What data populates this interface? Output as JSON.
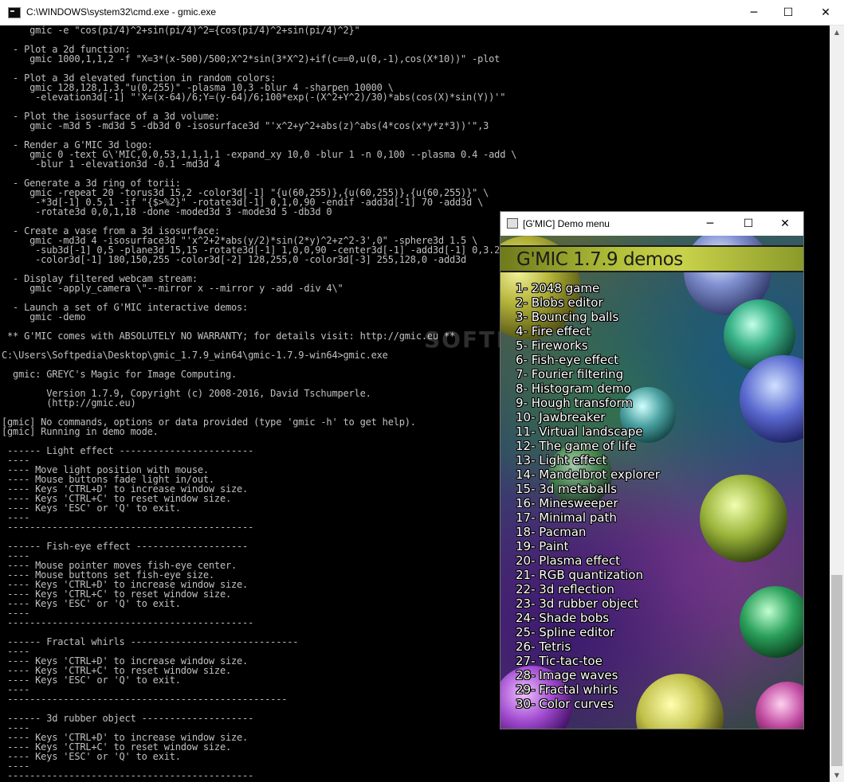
{
  "cmd": {
    "title": "C:\\WINDOWS\\system32\\cmd.exe - gmic.exe",
    "lines": [
      "     gmic -e \"cos(pi/4)^2+sin(pi/4)^2={cos(pi/4)^2+sin(pi/4)^2}\"",
      "",
      "  - Plot a 2d function:",
      "     gmic 1000,1,1,2 -f \"X=3*(x-500)/500;X^2*sin(3*X^2)+if(c==0,u(0,-1),cos(X*10))\" -plot",
      "",
      "  - Plot a 3d elevated function in random colors:",
      "     gmic 128,128,1,3,\"u(0,255)\" -plasma 10,3 -blur 4 -sharpen 10000 \\",
      "      -elevation3d[-1] \"'X=(x-64)/6;Y=(y-64)/6;100*exp(-(X^2+Y^2)/30)*abs(cos(X)*sin(Y))'\"",
      "",
      "  - Plot the isosurface of a 3d volume:",
      "     gmic -m3d 5 -md3d 5 -db3d 0 -isosurface3d \"'x^2+y^2+abs(z)^abs(4*cos(x*y*z*3))'\",3",
      "",
      "  - Render a G'MIC 3d logo:",
      "     gmic 0 -text G\\'MIC,0,0,53,1,1,1,1 -expand_xy 10,0 -blur 1 -n 0,100 --plasma 0.4 -add \\",
      "      -blur 1 -elevation3d -0.1 -md3d 4",
      "",
      "  - Generate a 3d ring of torii:",
      "     gmic -repeat 20 -torus3d 15,2 -color3d[-1] \"{u(60,255)},{u(60,255)},{u(60,255)}\" \\",
      "      -*3d[-1] 0.5,1 -if \"{$>%2}\" -rotate3d[-1] 0,1,0,90 -endif -add3d[-1] 70 -add3d \\",
      "      -rotate3d 0,0,1,18 -done -moded3d 3 -mode3d 5 -db3d 0",
      "",
      "  - Create a vase from a 3d isosurface:",
      "     gmic -md3d 4 -isosurface3d \"'x^2+2*abs(y/2)*sin(2*y)^2+z^2-3',0\" -sphere3d 1.5 \\",
      "      -sub3d[-1] 0,5 -plane3d 15,15 -rotate3d[-1] 1,0,0,90 -center3d[-1] -add3d[-1] 0,3.2 \\",
      "      -color3d[-1] 180,150,255 -color3d[-2] 128,255,0 -color3d[-3] 255,128,0 -add3d",
      "",
      "  - Display filtered webcam stream:",
      "     gmic -apply_camera \\\"--mirror x --mirror y -add -div 4\\\"",
      "",
      "  - Launch a set of G'MIC interactive demos:",
      "     gmic -demo",
      "",
      " ** G'MIC comes with ABSOLUTELY NO WARRANTY; for details visit: http://gmic.eu **",
      "",
      "C:\\Users\\Softpedia\\Desktop\\gmic_1.7.9_win64\\gmic-1.7.9-win64>gmic.exe",
      "",
      "  gmic: GREYC's Magic for Image Computing.",
      "",
      "        Version 1.7.9, Copyright (c) 2008-2016, David Tschumperle.",
      "        (http://gmic.eu)",
      "",
      "[gmic] No commands, options or data provided (type 'gmic -h' to get help).",
      "[gmic] Running in demo mode.",
      "",
      " ------ Light effect ------------------------",
      " ----",
      " ---- Move light position with mouse.",
      " ---- Mouse buttons fade light in/out.",
      " ---- Keys 'CTRL+D' to increase window size.",
      " ---- Keys 'CTRL+C' to reset window size.",
      " ---- Keys 'ESC' or 'Q' to exit.",
      " ----",
      " --------------------------------------------",
      "",
      " ------ Fish-eye effect --------------------",
      " ----",
      " ---- Mouse pointer moves fish-eye center.",
      " ---- Mouse buttons set fish-eye size.",
      " ---- Keys 'CTRL+D' to increase window size.",
      " ---- Keys 'CTRL+C' to reset window size.",
      " ---- Keys 'ESC' or 'Q' to exit.",
      " ----",
      " --------------------------------------------",
      "",
      " ------ Fractal whirls ------------------------------",
      " ----",
      " ---- Keys 'CTRL+D' to increase window size.",
      " ---- Keys 'CTRL+C' to reset window size.",
      " ---- Keys 'ESC' or 'Q' to exit.",
      " ----",
      " --------------------------------------------------",
      "",
      " ------ 3d rubber object --------------------",
      " ----",
      " ---- Keys 'CTRL+D' to increase window size.",
      " ---- Keys 'CTRL+C' to reset window size.",
      " ---- Keys 'ESC' or 'Q' to exit.",
      " ----",
      " --------------------------------------------"
    ]
  },
  "demo_window": {
    "title": "[G'MIC] Demo menu",
    "header": "G'MIC 1.7.9 demos",
    "items": [
      "1- 2048 game",
      "2- Blobs editor",
      "3- Bouncing balls",
      "4- Fire effect",
      "5- Fireworks",
      "6- Fish-eye effect",
      "7- Fourier filtering",
      "8- Histogram demo",
      "9- Hough transform",
      "10- Jawbreaker",
      "11- Virtual landscape",
      "12- The game of life",
      "13- Light effect",
      "14- Mandelbrot explorer",
      "15- 3d metaballs",
      "16- Minesweeper",
      "17- Minimal path",
      "18- Pacman",
      "19- Paint",
      "20- Plasma effect",
      "21- RGB quantization",
      "22- 3d reflection",
      "23- 3d rubber object",
      "24- Shade bobs",
      "25- Spline editor",
      "26- Tetris",
      "27- Tic-tac-toe",
      "28- Image waves",
      "29- Fractal whirls",
      "30- Color curves"
    ]
  },
  "watermark": "SOFTPEDIA",
  "window_controls": {
    "minimize": "─",
    "maximize": "☐",
    "close": "✕"
  }
}
